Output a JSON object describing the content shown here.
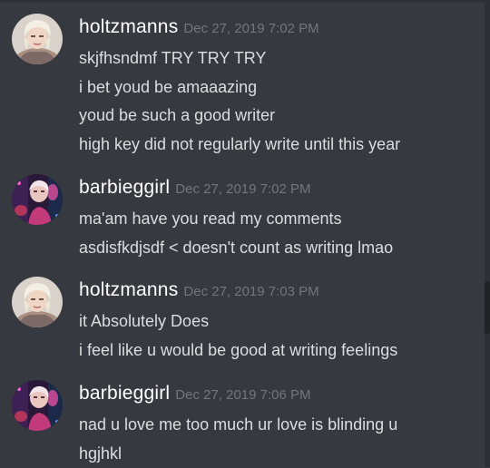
{
  "messages": [
    {
      "username": "holtzmanns",
      "timestamp": "Dec 27, 2019 7:02 PM",
      "avatar_icon": "user-avatar-platinum-hair",
      "lines": [
        "skjfhsndmf TRY TRY TRY",
        "i bet youd be amaaazing",
        "youd be such a good writer",
        "high key did not regularly write until this year"
      ]
    },
    {
      "username": "barbieggirl",
      "timestamp": "Dec 27, 2019 7:02 PM",
      "avatar_icon": "user-avatar-neon",
      "lines": [
        "ma'am have you read my comments",
        "asdisfkdjsdf < doesn't count as writing lmao"
      ]
    },
    {
      "username": "holtzmanns",
      "timestamp": "Dec 27, 2019 7:03 PM",
      "avatar_icon": "user-avatar-platinum-hair",
      "lines": [
        "it Absolutely Does",
        "i feel like u would be good at writing feelings"
      ]
    },
    {
      "username": "barbieggirl",
      "timestamp": "Dec 27, 2019 7:06 PM",
      "avatar_icon": "user-avatar-neon",
      "lines": [
        "nad u love me too much ur love is blinding u",
        "hgjhkl"
      ]
    }
  ],
  "colors": {
    "background": "#36393f",
    "username": "#ffffff",
    "timestamp": "#72767d",
    "message_text": "#dcddde"
  }
}
